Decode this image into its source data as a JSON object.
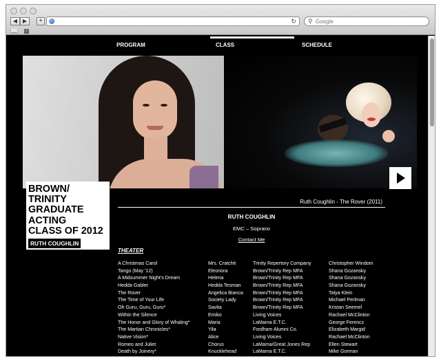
{
  "browser": {
    "url_value": "",
    "search_placeholder": "Google",
    "back_symbol": "◀",
    "forward_symbol": "▶",
    "add_symbol": "+",
    "reload_symbol": "↻",
    "bookmarks_symbol": "📖",
    "topsites_symbol": "▦"
  },
  "nav": {
    "items": [
      "PROGRAM",
      "CLASS",
      "SCHEDULE"
    ],
    "active_index": 1
  },
  "class_card": {
    "title_lines": [
      "BROWN/",
      "TRINITY",
      "GRADUATE",
      "ACTING",
      "CLASS OF 2012"
    ],
    "name": "RUTH COUGHLIN"
  },
  "media": {
    "caption": "Ruth Coughlin - The Rover (2011)"
  },
  "profile": {
    "name": "RUTH COUGHLIN",
    "role": "EMC – Soprano",
    "contact": "Contact Me"
  },
  "section_title": "THEATER",
  "credits": [
    [
      "A Christmas Carol",
      "Mrs. Cratchit",
      "Trinity Repertory Company",
      "Christopher Windom"
    ],
    [
      "Tango (May '12)",
      "Eleonora",
      "Brown/Trinity Rep MFA",
      "Shana Gozansky"
    ],
    [
      "A Midsummer Night's Dream",
      "Helena",
      "Brown/Trinity Rep MFA",
      "Shana Gozansky"
    ],
    [
      "Hedda Gabler",
      "Hedda Tesman",
      "Brown/Trinity Rep MFA",
      "Shana Gozansky"
    ],
    [
      "The Rover",
      "Angelica Bianca",
      "Brown/Trinity Rep MFA",
      "Talya Klein"
    ],
    [
      "The Time of Your Life",
      "Society Lady",
      "Brown/Trinity Rep MFA",
      "Michael Perlman"
    ],
    [
      "Oh Guru, Guru, Guru*",
      "Savita",
      "Brown/Trinity Rep MFA",
      "Kristan Seemel"
    ],
    [
      "Within the Silence",
      "Emiko",
      "Living Voices",
      "Rachael McClinton"
    ],
    [
      "The Honor and Glory of Whaling*",
      "Maria",
      "LaMama E.T.C.",
      "George Ferencz"
    ],
    [
      "The Martian Chronicles*",
      "Yila",
      "Fordham Alumni Co.",
      "Elizabeth Margid"
    ],
    [
      "Native Vision*",
      "Alice",
      "Living Voices",
      "Rachael McClinton"
    ],
    [
      "Romeo and Juliet",
      "Chorus",
      "LaMama/Great Jones Rep",
      "Ellen Stewart"
    ],
    [
      "Death by Joinery*",
      "Knucklehead",
      "LaMama E.T.C.",
      "Mike Gorman"
    ]
  ]
}
